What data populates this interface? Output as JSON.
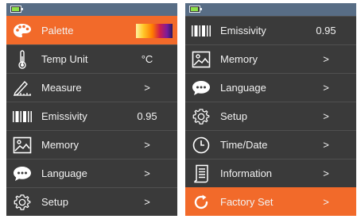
{
  "status": {
    "battery_level": 0.85,
    "battery_color": "#8de04a",
    "bar_color": "#586d85"
  },
  "accent_color": "#f26a2a",
  "left_screen": {
    "items": [
      {
        "icon": "palette-icon",
        "label": "Palette",
        "value": "",
        "active": true
      },
      {
        "icon": "thermometer-icon",
        "label": "Temp Unit",
        "value": "°C",
        "active": false
      },
      {
        "icon": "ruler-pencil-icon",
        "label": "Measure",
        "value": ">",
        "active": false
      },
      {
        "icon": "barcode-icon",
        "label": "Emissivity",
        "value": "0.95",
        "active": false
      },
      {
        "icon": "image-icon",
        "label": "Memory",
        "value": ">",
        "active": false
      },
      {
        "icon": "chat-bubble-icon",
        "label": "Language",
        "value": ">",
        "active": false
      },
      {
        "icon": "gear-icon",
        "label": "Setup",
        "value": ">",
        "active": false
      }
    ]
  },
  "right_screen": {
    "items": [
      {
        "icon": "barcode-icon",
        "label": "Emissivity",
        "value": "0.95",
        "active": false
      },
      {
        "icon": "image-icon",
        "label": "Memory",
        "value": ">",
        "active": false
      },
      {
        "icon": "chat-bubble-icon",
        "label": "Language",
        "value": ">",
        "active": false
      },
      {
        "icon": "gear-icon",
        "label": "Setup",
        "value": ">",
        "active": false
      },
      {
        "icon": "clock-icon",
        "label": "Time/Date",
        "value": ">",
        "active": false
      },
      {
        "icon": "document-icon",
        "label": "Information",
        "value": ">",
        "active": false
      },
      {
        "icon": "refresh-icon",
        "label": "Factory Set",
        "value": ">",
        "active": true
      }
    ]
  }
}
